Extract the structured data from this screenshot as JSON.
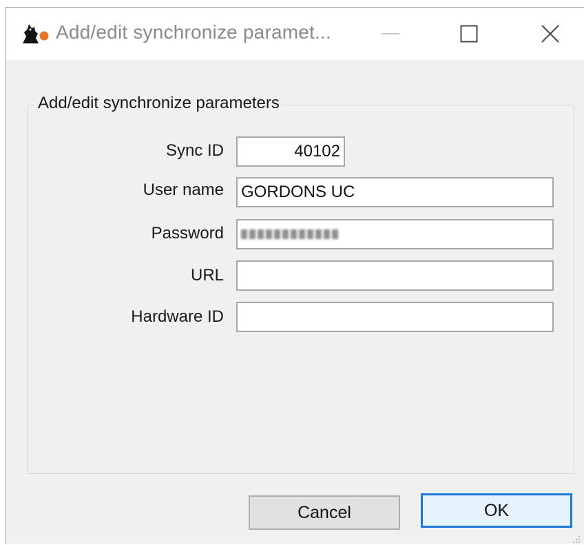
{
  "window": {
    "title": "Add/edit synchronize paramet...",
    "minimize_icon": "minimize-icon",
    "maximize_icon": "maximize-icon",
    "close_icon": "close-icon",
    "app_icon": "app-logo-icon"
  },
  "group": {
    "legend": "Add/edit synchronize parameters"
  },
  "fields": {
    "sync_id": {
      "label": "Sync ID",
      "value": "40102"
    },
    "user_name": {
      "label": "User name",
      "value": "GORDONS UC"
    },
    "password": {
      "label": "Password",
      "value_masked": true
    },
    "url": {
      "label": "URL",
      "value": ""
    },
    "hardware_id": {
      "label": "Hardware ID",
      "value": ""
    }
  },
  "buttons": {
    "cancel": "Cancel",
    "ok": "OK"
  },
  "colors": {
    "ok_border": "#1e78d4",
    "title_text": "#8a8a8a",
    "app_icon_accent": "#e9732a"
  }
}
